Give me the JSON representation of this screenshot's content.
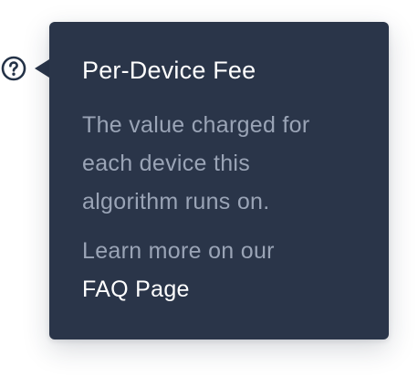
{
  "help_icon": {
    "icon": "question-circle-icon",
    "color": "#243247"
  },
  "tooltip": {
    "background": "#2a3549",
    "title": "Per-Device Fee",
    "body": "The value charged for each device this algorithm  runs on.",
    "learn_more_prefix": "Learn more on our",
    "link_label": "FAQ Page"
  }
}
